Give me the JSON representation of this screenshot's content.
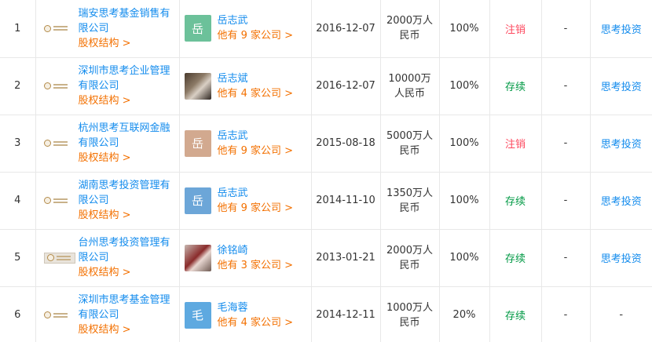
{
  "rows": [
    {
      "index": "1",
      "company_name": "瑞安思考基金销售有限公司",
      "equity_label": "股权结构 >",
      "logo_style": "plain",
      "avatar_char": "岳",
      "avatar_color": "#6cc19a",
      "avatar_type": "char",
      "person_name": "岳志武",
      "person_more": "他有 9 家公司 >",
      "date": "2016-12-07",
      "capital": "2000万人民币",
      "ratio": "100%",
      "status": "注销",
      "status_type": "cancel",
      "dash": "-",
      "investor": "思考投资"
    },
    {
      "index": "2",
      "company_name": "深圳市思考企业管理有限公司",
      "equity_label": "股权结构 >",
      "logo_style": "plain",
      "avatar_char": "",
      "avatar_color": "",
      "avatar_type": "photo",
      "person_name": "岳志斌",
      "person_more": "他有 4 家公司 >",
      "date": "2016-12-07",
      "capital": "10000万人民币",
      "ratio": "100%",
      "status": "存续",
      "status_type": "active",
      "dash": "-",
      "investor": "思考投资"
    },
    {
      "index": "3",
      "company_name": "杭州思考互联网金融有限公司",
      "equity_label": "股权结构 >",
      "logo_style": "plain",
      "avatar_char": "岳",
      "avatar_color": "#d2a98f",
      "avatar_type": "char",
      "person_name": "岳志武",
      "person_more": "他有 9 家公司 >",
      "date": "2015-08-18",
      "capital": "5000万人民币",
      "ratio": "100%",
      "status": "注销",
      "status_type": "cancel",
      "dash": "-",
      "investor": "思考投资"
    },
    {
      "index": "4",
      "company_name": "湖南思考投资管理有限公司",
      "equity_label": "股权结构 >",
      "logo_style": "plain",
      "avatar_char": "岳",
      "avatar_color": "#6ca6d8",
      "avatar_type": "char",
      "person_name": "岳志武",
      "person_more": "他有 9 家公司 >",
      "date": "2014-11-10",
      "capital": "1350万人民币",
      "ratio": "100%",
      "status": "存续",
      "status_type": "active",
      "dash": "-",
      "investor": "思考投资"
    },
    {
      "index": "5",
      "company_name": "台州思考投资管理有限公司",
      "equity_label": "股权结构 >",
      "logo_style": "boxed",
      "avatar_char": "",
      "avatar_color": "",
      "avatar_type": "photo2",
      "person_name": "徐铭崎",
      "person_more": "他有 3 家公司 >",
      "date": "2013-01-21",
      "capital": "2000万人民币",
      "ratio": "100%",
      "status": "存续",
      "status_type": "active",
      "dash": "-",
      "investor": "思考投资"
    },
    {
      "index": "6",
      "company_name": "深圳市思考基金管理有限公司",
      "equity_label": "股权结构 >",
      "logo_style": "plain",
      "avatar_char": "毛",
      "avatar_color": "#5ea9e0",
      "avatar_type": "char",
      "person_name": "毛海蓉",
      "person_more": "他有 4 家公司 >",
      "date": "2014-12-11",
      "capital": "1000万人民币",
      "ratio": "20%",
      "status": "存续",
      "status_type": "active",
      "dash": "-",
      "investor": "-"
    }
  ]
}
